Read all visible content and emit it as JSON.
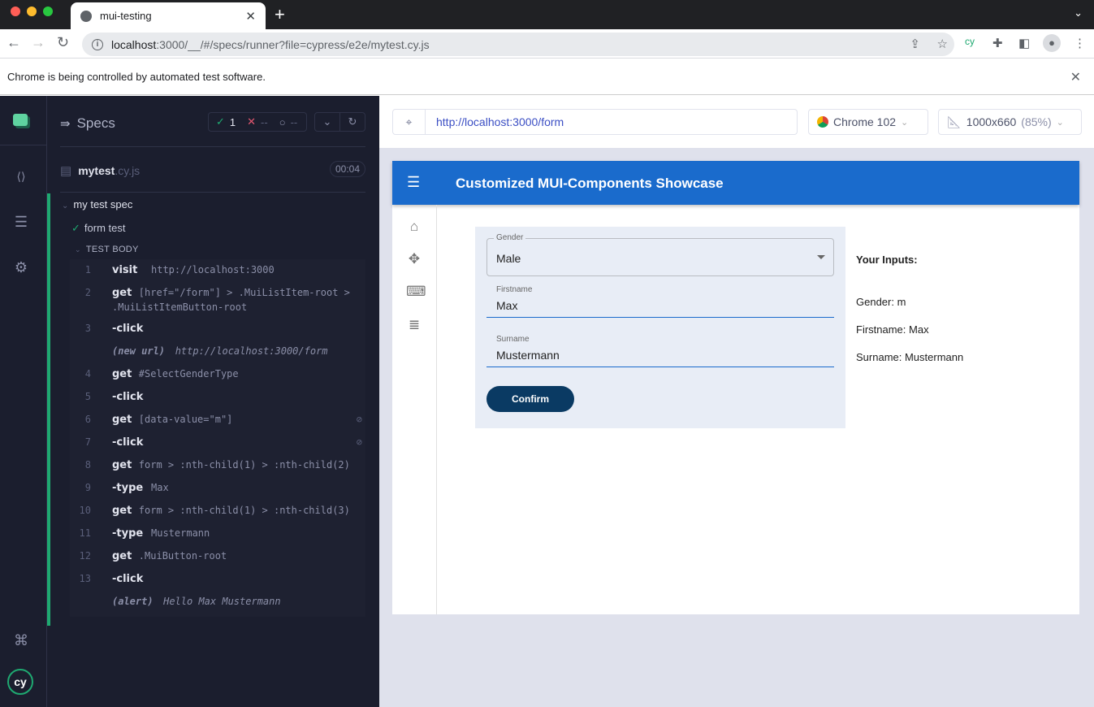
{
  "browser": {
    "tab_title": "mui-testing",
    "url_host": "localhost",
    "url_rest": ":3000/__/#/specs/runner?file=cypress/e2e/mytest.cy.js",
    "infobar_text": "Chrome is being controlled by automated test software."
  },
  "reporter": {
    "title": "Specs",
    "passed": "1",
    "failed": "--",
    "pending": "--",
    "spec_name": "mytest",
    "spec_ext": ".cy.js",
    "duration": "00:04",
    "suite": "my test spec",
    "test": "form test",
    "body_label": "TEST BODY",
    "commands": [
      {
        "num": "1",
        "name": "visit",
        "msg": "http://localhost:3000"
      },
      {
        "num": "2",
        "name": "get",
        "msg": "[href=\"/form\"] > .MuiListItem-root >",
        "msg2": ".MuiListItemButton-root"
      },
      {
        "num": "3",
        "name": "-click",
        "msg": ""
      },
      {
        "num": "",
        "name": "(new url)",
        "msg": "http://localhost:3000/form",
        "italic": true
      },
      {
        "num": "4",
        "name": "get",
        "msg": "#SelectGenderType"
      },
      {
        "num": "5",
        "name": "-click",
        "msg": ""
      },
      {
        "num": "6",
        "name": "get",
        "msg": "[data-value=\"m\"]",
        "hidden": true
      },
      {
        "num": "7",
        "name": "-click",
        "msg": "",
        "hidden": true
      },
      {
        "num": "8",
        "name": "get",
        "msg": "form > :nth-child(1) > :nth-child(2)"
      },
      {
        "num": "9",
        "name": "-type",
        "msg": "Max"
      },
      {
        "num": "10",
        "name": "get",
        "msg": "form > :nth-child(1) > :nth-child(3)"
      },
      {
        "num": "11",
        "name": "-type",
        "msg": "Mustermann"
      },
      {
        "num": "12",
        "name": "get",
        "msg": ".MuiButton-root"
      },
      {
        "num": "13",
        "name": "-click",
        "msg": ""
      },
      {
        "num": "",
        "name": "(alert)",
        "msg": "Hello Max Mustermann",
        "italic": true
      }
    ]
  },
  "aut": {
    "url": "http://localhost:3000/form",
    "browser": "Chrome 102",
    "viewport": "1000x660",
    "scale": "(85%)"
  },
  "app": {
    "title": "Customized MUI-Components Showcase",
    "gender_label": "Gender",
    "gender_value": "Male",
    "firstname_label": "Firstname",
    "firstname_value": "Max",
    "surname_label": "Surname",
    "surname_value": "Mustermann",
    "confirm_label": "Confirm",
    "inputs_heading": "Your Inputs:",
    "out_gender": "Gender: m",
    "out_firstname": "Firstname: Max",
    "out_surname": "Surname: Mustermann"
  },
  "colors": {
    "accent": "#1a6bcc",
    "pass": "#1fa971",
    "fail": "#e45770",
    "button": "#0a3a63"
  }
}
